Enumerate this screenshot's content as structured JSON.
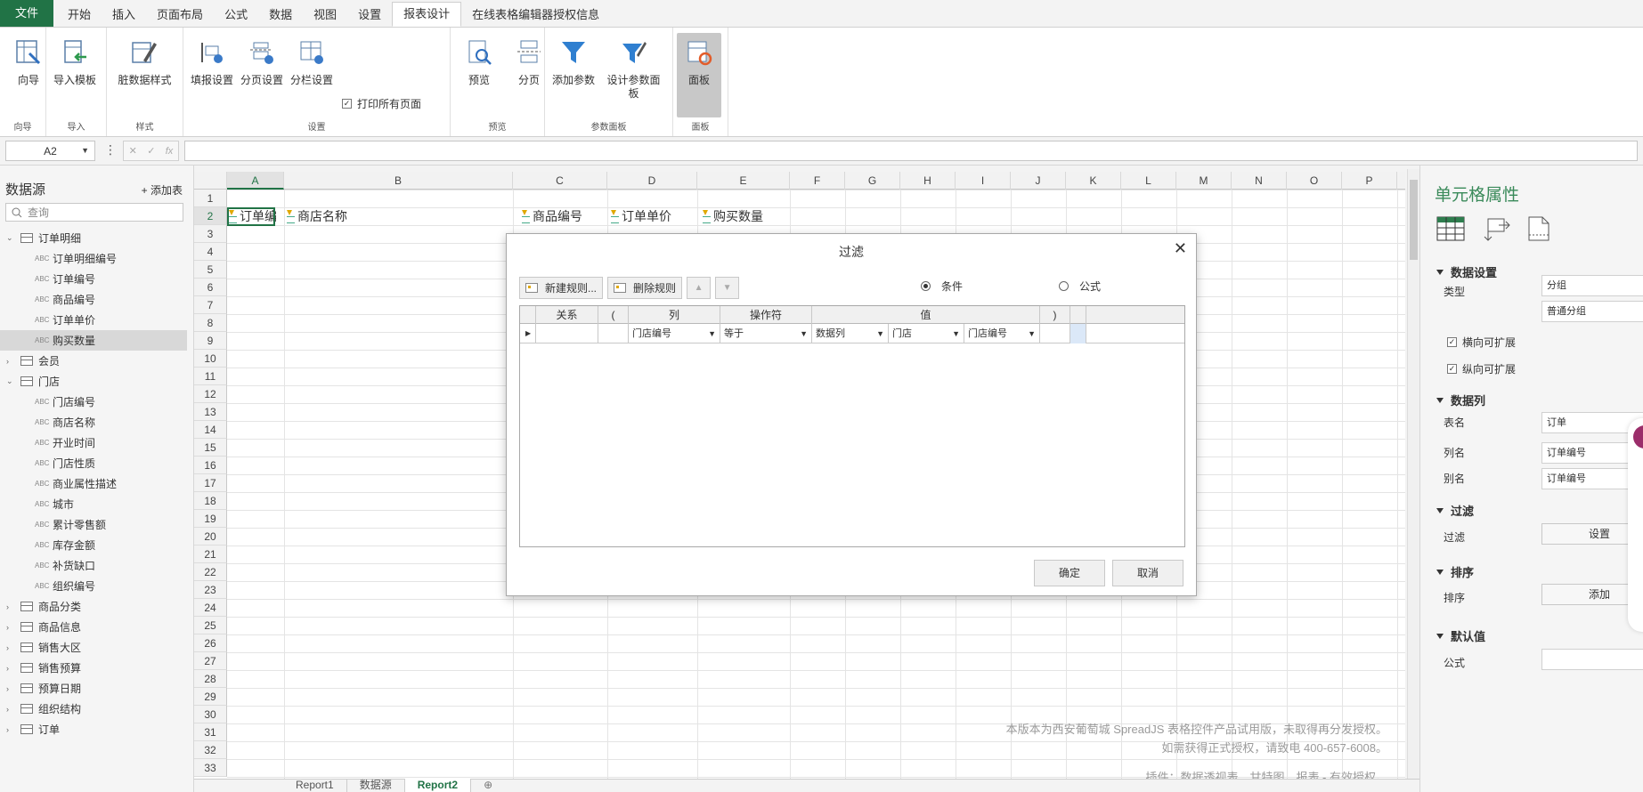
{
  "ribbon": {
    "tabs": [
      "文件",
      "开始",
      "插入",
      "页面布局",
      "公式",
      "数据",
      "视图",
      "设置",
      "报表设计",
      "在线表格编辑器授权信息"
    ],
    "active_tab": "报表设计",
    "groups": {
      "wizard": {
        "label": "向导",
        "btn": "向导"
      },
      "import": {
        "label": "导入",
        "btn": "导入模板"
      },
      "style": {
        "label": "样式",
        "btn": "脏数据样式"
      },
      "settings": {
        "label": "设置",
        "b1": "填报设置",
        "b2": "分页设置",
        "b3": "分栏设置",
        "print_all": "打印所有页面"
      },
      "preview": {
        "label": "预览",
        "b1": "预览",
        "b2": "分页"
      },
      "params": {
        "label": "参数面板",
        "b1": "添加参数",
        "b2": "设计参数面板"
      },
      "panel": {
        "label": "面板",
        "b1": "面板"
      }
    }
  },
  "formula_bar": {
    "cell_ref": "A2",
    "fx": "fx"
  },
  "datasource": {
    "title": "数据源",
    "add_table": "+ 添加表",
    "search_placeholder": "查询",
    "t_order": "订单明细",
    "order_fields": [
      "订单明细编号",
      "订单编号",
      "商品编号",
      "订单单价",
      "购买数量"
    ],
    "t_member": "会员",
    "t_store": "门店",
    "store_fields": [
      "门店编号",
      "商店名称",
      "开业时间",
      "门店性质",
      "商业属性描述",
      "城市",
      "累计零售额",
      "库存金额",
      "补货缺口",
      "组织编号"
    ],
    "tables_rest": [
      "商品分类",
      "商品信息",
      "销售大区",
      "销售预算",
      "预算日期",
      "组织结构",
      "订单"
    ]
  },
  "grid": {
    "columns": [
      "A",
      "B",
      "C",
      "D",
      "E",
      "F",
      "G",
      "H",
      "I",
      "J",
      "K",
      "L",
      "M",
      "N",
      "O",
      "P"
    ],
    "rows": [
      "1",
      "2",
      "3",
      "4",
      "5",
      "6",
      "7",
      "8",
      "9",
      "10",
      "11",
      "12",
      "13",
      "14",
      "15",
      "16",
      "17",
      "18",
      "19",
      "20",
      "21",
      "22",
      "23",
      "24",
      "25",
      "26",
      "27",
      "28",
      "29",
      "30",
      "31",
      "32",
      "33"
    ],
    "cells": {
      "a2": "订单编",
      "b2": "商店名称",
      "c2": "商品编号",
      "d2": "订单单价",
      "e2": "购买数量"
    },
    "watermark1": "本版本为西安葡萄城 SpreadJS 表格控件产品试用版，未取得再分发授权。",
    "watermark2": "如需获得正式授权，请致电 400-657-6008。",
    "watermark3": "插件：数据透视表、甘特图、报表 - 有效授权。"
  },
  "sheets": [
    "Report1",
    "数据源",
    "Report2"
  ],
  "active_sheet": "Report2",
  "properties": {
    "title": "单元格属性",
    "sec_data": "数据设置",
    "type_label": "类型",
    "type_value": "分组",
    "group_value": "普通分组",
    "h_expand": "横向可扩展",
    "v_expand": "纵向可扩展",
    "sec_col": "数据列",
    "table_label": "表名",
    "table_value": "订单",
    "col_label": "列名",
    "col_value": "订单编号",
    "alias_label": "别名",
    "alias_value": "订单编号",
    "sec_filter": "过滤",
    "filter_label": "过滤",
    "filter_btn": "设置",
    "sec_sort": "排序",
    "sort_label": "排序",
    "sort_btn": "添加",
    "sec_default": "默认值",
    "formula_label": "公式"
  },
  "filter_dialog": {
    "title": "过滤",
    "new_rule": "新建规则...",
    "delete_rule": "删除规则",
    "radio_condition": "条件",
    "radio_formula": "公式",
    "headers": {
      "relation": "关系",
      "lparen": "(",
      "column": "列",
      "operator": "操作符",
      "value": "值",
      "rparen": ")"
    },
    "row": {
      "column": "门店编号",
      "operator": "等于",
      "value_type": "数据列",
      "value_table": "门店",
      "value_column": "门店编号"
    },
    "ok": "确定",
    "cancel": "取消"
  }
}
